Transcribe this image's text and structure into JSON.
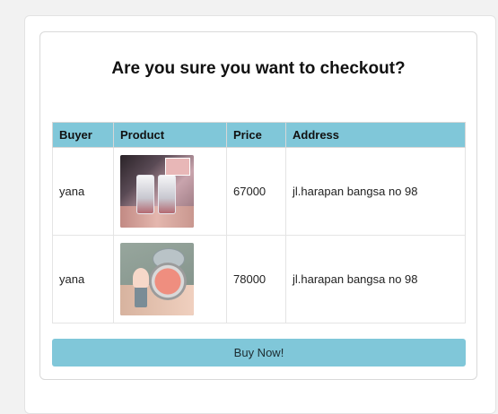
{
  "dialog": {
    "title": "Are you sure you want to checkout?",
    "buy_label": "Buy Now!"
  },
  "table": {
    "headers": [
      "Buyer",
      "Product",
      "Price",
      "Address"
    ],
    "rows": [
      {
        "buyer": "yana",
        "product_image": "lip-gloss-product-photo",
        "price": "67000",
        "address": "jl.harapan bangsa no 98"
      },
      {
        "buyer": "yana",
        "product_image": "blush-compact-product-photo",
        "price": "78000",
        "address": "jl.harapan bangsa no 98"
      }
    ]
  },
  "colors": {
    "accent": "#80c7d9"
  }
}
